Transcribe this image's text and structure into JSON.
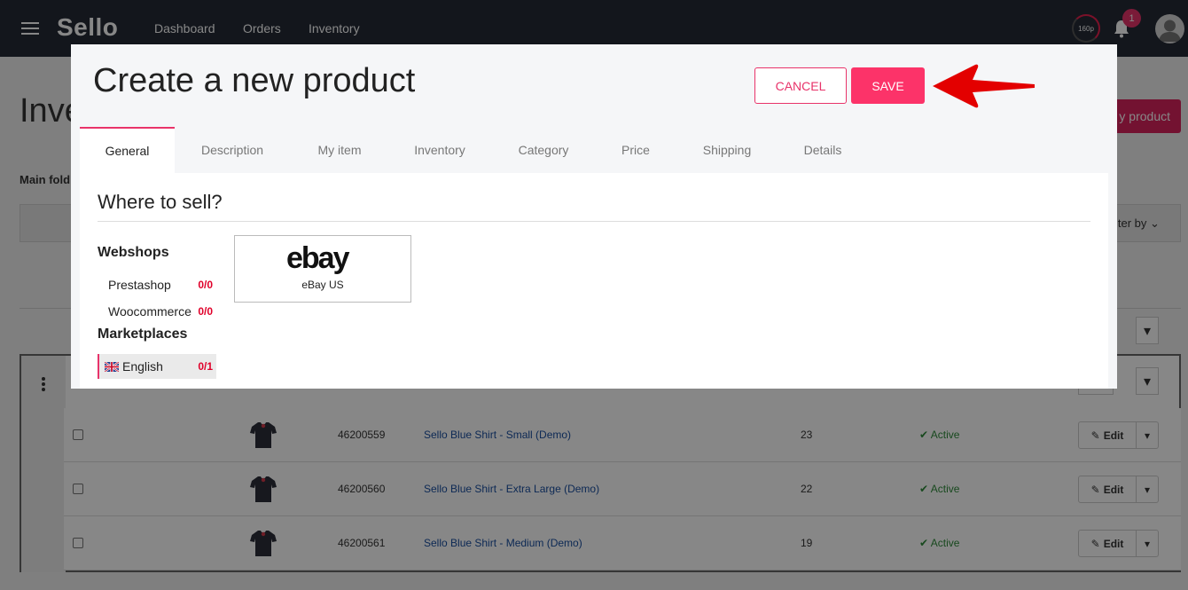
{
  "app": {
    "logo": "Sello",
    "speed": "160p",
    "notifications": "1"
  },
  "nav": {
    "items": [
      "Dashboard",
      "Orders",
      "Inventory"
    ]
  },
  "background": {
    "title": "Inve",
    "add_button": "y product",
    "main_folder": "Main fold",
    "filter": "lter by",
    "edit_partial": "it",
    "rows": [
      {
        "sku": "46200559",
        "name": "Sello Blue Shirt - Small (Demo)",
        "qty": "23",
        "status": "Active",
        "edit": "Edit"
      },
      {
        "sku": "46200560",
        "name": "Sello Blue Shirt - Extra Large (Demo)",
        "qty": "22",
        "status": "Active",
        "edit": "Edit"
      },
      {
        "sku": "46200561",
        "name": "Sello Blue Shirt - Medium (Demo)",
        "qty": "19",
        "status": "Active",
        "edit": "Edit"
      }
    ]
  },
  "modal": {
    "title": "Create a new product",
    "cancel": "CANCEL",
    "save": "SAVE",
    "tabs": [
      "General",
      "Description",
      "My item",
      "Inventory",
      "Category",
      "Price",
      "Shipping",
      "Details"
    ],
    "active_tab": "General",
    "section_title": "Where to sell?",
    "webshops": {
      "heading": "Webshops",
      "items": [
        {
          "label": "Prestashop",
          "count": "0/0"
        },
        {
          "label": "Woocommerce",
          "count": "0/0"
        }
      ]
    },
    "marketplaces": {
      "heading": "Marketplaces",
      "items": [
        {
          "label": "English",
          "count": "0/1",
          "flag": "uk-flag-icon"
        }
      ]
    },
    "channel_card": {
      "logo": "ebay",
      "label": "eBay US"
    }
  },
  "colors": {
    "accent": "#e8336a",
    "save": "#fc3369",
    "nav_bg": "#242b36",
    "arrow": "#e30000",
    "count": "#e0002a"
  }
}
